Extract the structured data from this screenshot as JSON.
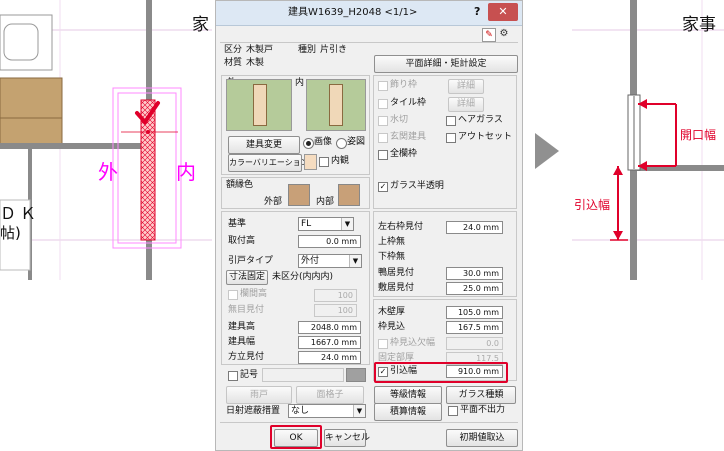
{
  "left_plan": {
    "room_char": "家",
    "gaibu": "外",
    "naibu": "内",
    "room_label_1": "ＤＫ",
    "room_label_2": "帖)"
  },
  "dialog": {
    "title": "建具W1639_H2048 <1/1>",
    "help": "?",
    "close": "✕",
    "kubun_label": "区分",
    "kubun_value": "木製戸",
    "shubetsu_label": "種別",
    "shubetsu_value": "片引き",
    "zaishitsu_label": "材質",
    "zaishitsu_value": "木製",
    "heimen_button": "平面詳細・矩計設定",
    "soto_label": "外",
    "uchi_label": "内",
    "tategu_henkou": "建具変更",
    "radio_gazou": "画像",
    "radio_zushi": "姿図",
    "color_variation": "カラーバリエーション",
    "uchikan": "内観",
    "waku_iro": "額縁色",
    "gaibu": "外部",
    "naibu": "内部",
    "kazariwaku": "飾り枠",
    "tairuwaku": "タイル枠",
    "mizukiri": "水切",
    "genkan_tategu": "玄関建具",
    "zen_kashiwaku": "全欄枠",
    "detail_1": "詳細",
    "detail_2": "詳細",
    "hea_garasu": "ヘアガラス",
    "autoset": "アウトセット",
    "glass_semi": "ガラス半透明",
    "kijun_label": "基準",
    "kijun_value": "FL",
    "toritsuke_label": "取付高",
    "toritsuke_value": "0.0 mm",
    "hikido_label": "引戸タイプ",
    "hikido_value": "外付",
    "sunpou_button": "寸法固定",
    "sunpou_value": "未区分(内内内)",
    "ranma_label": "欄間高",
    "ranma_value": "100",
    "muji_label": "無目見付",
    "muji_value": "100",
    "tategu_taka_label": "建具高",
    "tategu_taka_value": "2048.0 mm",
    "tategu_haba_label": "建具幅",
    "tategu_haba_value": "1667.0 mm",
    "houdachi_label": "方立見付",
    "houdachi_value": "24.0 mm",
    "kigou": "記号",
    "sayuu_label": "左右枠見付",
    "sayuu_value": "24.0 mm",
    "uewaku": "上枠無",
    "shitawaku": "下枠無",
    "kamoi_label": "鴨居見付",
    "kamoi_value": "30.0 mm",
    "shikii_label": "敷居見付",
    "shikii_value": "25.0 mm",
    "kabeatsu_label": "木壁厚",
    "kabeatsu_value": "105.0 mm",
    "wakumikomi_label": "枠見込",
    "wakumikomi_value": "167.5 mm",
    "wakumikomi_kesu_label": "枠見込欠幅",
    "wakumikomi_kesu_value": "0.0",
    "koteibu_label": "固定部厚",
    "koteibu_value": "117.5",
    "hikikomi_label": "引込幅",
    "hikikomi_value": "910.0 mm",
    "amado": "雨戸",
    "mengoushi": "面格子",
    "toukyuu": "等級情報",
    "garasu_shurui": "ガラス種類",
    "sekisan": "積算情報",
    "heimen_fushutsuryoku": "平面不出力",
    "hizashi_label": "日射遮蔽措置",
    "hizashi_value": "なし",
    "ok": "OK",
    "cancel": "キャンセル",
    "shokichi": "初期値取込"
  },
  "right_plan": {
    "room_char": "家事",
    "kaikou_label": "開口幅",
    "hikikomi_label": "引込幅"
  },
  "colors": {
    "accent": "#e0002a",
    "magenta": "#ff00ff",
    "wall": "#8a8a8a",
    "arrow": "#909090"
  }
}
